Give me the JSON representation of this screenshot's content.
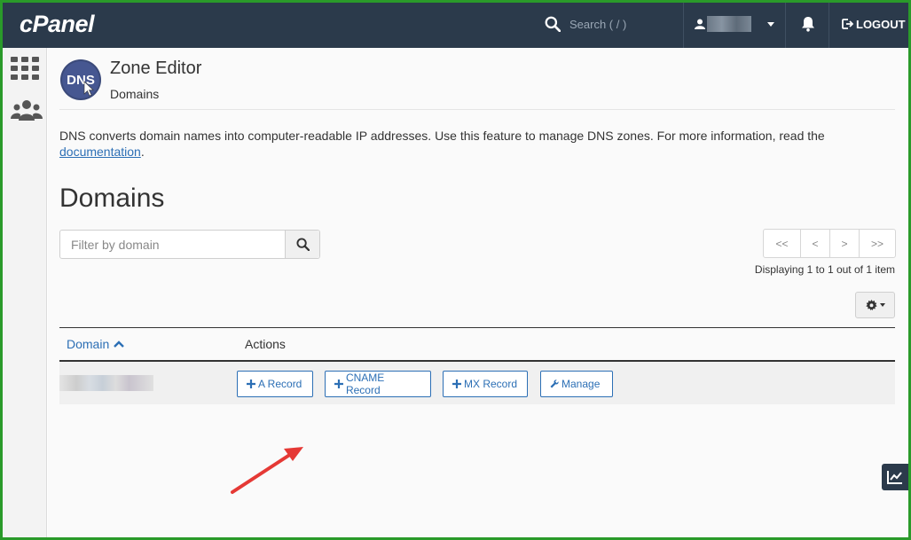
{
  "app": {
    "logo_text": "cPanel"
  },
  "header": {
    "search_placeholder": "Search ( / )",
    "logout_label": "LOGOUT"
  },
  "page": {
    "title": "Zone Editor",
    "subtitle": "Domains",
    "logo_text": "DNS",
    "description": "DNS converts domain names into computer-readable IP addresses. Use this feature to manage DNS zones. For more information, read the",
    "description_link": "documentation",
    "description_end": "."
  },
  "domains": {
    "title": "Domains",
    "filter_placeholder": "Filter by domain",
    "pagination": {
      "first": "<<",
      "prev": "<",
      "next": ">",
      "last": ">>"
    },
    "display_text": "Displaying 1 to 1 out of 1 item",
    "columns": {
      "domain": "Domain",
      "actions": "Actions"
    },
    "row_actions": {
      "a_record": "A Record",
      "cname_record": "CNAME Record",
      "mx_record": "MX Record",
      "manage": "Manage"
    }
  },
  "colors": {
    "topbar": "#2b3a4b",
    "link": "#2c6fb5",
    "frame": "#2a9a2a",
    "annotation_arrow": "#e53935"
  },
  "icons": {
    "search": "search-icon",
    "user": "user-icon",
    "bell": "bell-icon",
    "logout": "logout-icon",
    "apps": "grid-icon",
    "users": "users-icon",
    "gear": "gear-icon",
    "plus": "plus-icon",
    "wrench": "wrench-icon",
    "stats": "chart-line-icon"
  }
}
